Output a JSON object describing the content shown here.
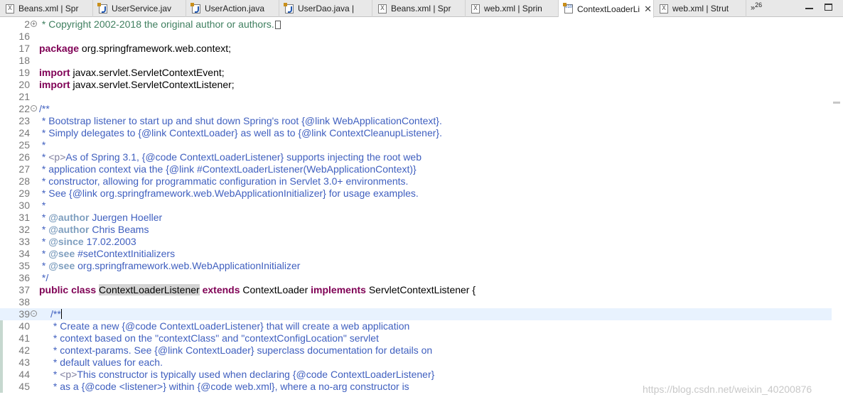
{
  "tabs": [
    {
      "label": "Beans.xml | Spr",
      "icon": "xml-file-icon"
    },
    {
      "label": "UserService.jav",
      "icon": "java-file-icon"
    },
    {
      "label": "UserAction.java",
      "icon": "java-file-icon"
    },
    {
      "label": "UserDao.java |",
      "icon": "java-file-icon"
    },
    {
      "label": "Beans.xml | Spr",
      "icon": "xml-file-icon"
    },
    {
      "label": "web.xml | Sprin",
      "icon": "xml-file-icon"
    },
    {
      "label": "ContextLoaderLi",
      "icon": "class-file-icon",
      "active": true
    },
    {
      "label": "web.xml | Strut",
      "icon": "xml-file-icon"
    }
  ],
  "tab_overflow": {
    "chevrons": "»",
    "count": "26"
  },
  "close_glyph": "✕",
  "xml_icon_glyph": "X",
  "class_icon_glyph": "010",
  "code_lines": [
    {
      "n": "2",
      "fold": "+",
      "parts": [
        {
          "t": " * Copyright 2002-2018 the original author or authors.",
          "c": "cm"
        }
      ],
      "box": true
    },
    {
      "n": "16",
      "parts": []
    },
    {
      "n": "17",
      "parts": [
        {
          "t": "package",
          "c": "kw"
        },
        {
          "t": " org.springframework.web.context;",
          "c": "pl"
        }
      ]
    },
    {
      "n": "18",
      "parts": []
    },
    {
      "n": "19",
      "parts": [
        {
          "t": "import",
          "c": "kw"
        },
        {
          "t": " javax.servlet.ServletContextEvent;",
          "c": "pl"
        }
      ]
    },
    {
      "n": "20",
      "parts": [
        {
          "t": "import",
          "c": "kw"
        },
        {
          "t": " javax.servlet.ServletContextListener;",
          "c": "pl"
        }
      ]
    },
    {
      "n": "21",
      "parts": []
    },
    {
      "n": "22",
      "fold": "-",
      "parts": [
        {
          "t": "/**",
          "c": "jd"
        }
      ]
    },
    {
      "n": "23",
      "parts": [
        {
          "t": " * Bootstrap listener to start up and shut down Spring's root {@link WebApplicationContext}.",
          "c": "jd"
        }
      ]
    },
    {
      "n": "24",
      "parts": [
        {
          "t": " * Simply delegates to {@link ContextLoader} as well as to {@link ContextCleanupListener}.",
          "c": "jd"
        }
      ]
    },
    {
      "n": "25",
      "parts": [
        {
          "t": " *",
          "c": "jd"
        }
      ]
    },
    {
      "n": "26",
      "parts": [
        {
          "t": " * ",
          "c": "jd"
        },
        {
          "t": "<p>",
          "c": "jdh"
        },
        {
          "t": "As of Spring 3.1, {@code ContextLoaderListener} supports injecting the root web",
          "c": "jd"
        }
      ]
    },
    {
      "n": "27",
      "parts": [
        {
          "t": " * application context via the {@link #ContextLoaderListener(WebApplicationContext)}",
          "c": "jd"
        }
      ]
    },
    {
      "n": "28",
      "parts": [
        {
          "t": " * constructor, allowing for programmatic configuration in Servlet 3.0+ environments.",
          "c": "jd"
        }
      ]
    },
    {
      "n": "29",
      "parts": [
        {
          "t": " * See {@link org.springframework.web.WebApplicationInitializer} for usage examples.",
          "c": "jd"
        }
      ]
    },
    {
      "n": "30",
      "parts": [
        {
          "t": " *",
          "c": "jd"
        }
      ]
    },
    {
      "n": "31",
      "parts": [
        {
          "t": " * ",
          "c": "jd"
        },
        {
          "t": "@author",
          "c": "jdtag"
        },
        {
          "t": " Juergen Hoeller",
          "c": "jd"
        }
      ]
    },
    {
      "n": "32",
      "parts": [
        {
          "t": " * ",
          "c": "jd"
        },
        {
          "t": "@author",
          "c": "jdtag"
        },
        {
          "t": " Chris Beams",
          "c": "jd"
        }
      ]
    },
    {
      "n": "33",
      "parts": [
        {
          "t": " * ",
          "c": "jd"
        },
        {
          "t": "@since",
          "c": "jdtag"
        },
        {
          "t": " 17.02.2003",
          "c": "jd"
        }
      ]
    },
    {
      "n": "34",
      "parts": [
        {
          "t": " * ",
          "c": "jd"
        },
        {
          "t": "@see",
          "c": "jdtag"
        },
        {
          "t": " #setContextInitializers",
          "c": "jd"
        }
      ]
    },
    {
      "n": "35",
      "parts": [
        {
          "t": " * ",
          "c": "jd"
        },
        {
          "t": "@see",
          "c": "jdtag"
        },
        {
          "t": " org.springframework.web.WebApplicationInitializer",
          "c": "jd"
        }
      ]
    },
    {
      "n": "36",
      "parts": [
        {
          "t": " */",
          "c": "jd"
        }
      ]
    },
    {
      "n": "37",
      "parts": [
        {
          "t": "public class",
          "c": "kw"
        },
        {
          "t": " ",
          "c": "pl"
        },
        {
          "t": "ContextLoaderListener",
          "c": "pl",
          "hl": true
        },
        {
          "t": " ",
          "c": "pl"
        },
        {
          "t": "extends",
          "c": "kw"
        },
        {
          "t": " ContextLoader ",
          "c": "pl"
        },
        {
          "t": "implements",
          "c": "kw"
        },
        {
          "t": " ServletContextListener {",
          "c": "pl"
        }
      ]
    },
    {
      "n": "38",
      "parts": []
    },
    {
      "n": "39",
      "fold": "-",
      "current": true,
      "indent": true,
      "caret": true,
      "parts": [
        {
          "t": "/**",
          "c": "jd"
        }
      ]
    },
    {
      "n": "40",
      "indent": true,
      "parts": [
        {
          "t": " * Create a new {@code ContextLoaderListener} that will create a web application",
          "c": "jd"
        }
      ]
    },
    {
      "n": "41",
      "indent": true,
      "parts": [
        {
          "t": " * context based on the \"contextClass\" and \"contextConfigLocation\" servlet",
          "c": "jd"
        }
      ]
    },
    {
      "n": "42",
      "indent": true,
      "parts": [
        {
          "t": " * context-params. See {@link ContextLoader} superclass documentation for details on",
          "c": "jd"
        }
      ]
    },
    {
      "n": "43",
      "indent": true,
      "parts": [
        {
          "t": " * default values for each.",
          "c": "jd"
        }
      ]
    },
    {
      "n": "44",
      "indent": true,
      "parts": [
        {
          "t": " * ",
          "c": "jd"
        },
        {
          "t": "<p>",
          "c": "jdh"
        },
        {
          "t": "This constructor is typically used when declaring {@code ContextLoaderListener}",
          "c": "jd"
        }
      ]
    },
    {
      "n": "45",
      "indent": true,
      "parts": [
        {
          "t": " * as a {@code <listener>} within {@code web.xml}, where a no-arg constructor is",
          "c": "jd"
        }
      ]
    }
  ],
  "watermark": "https://blog.csdn.net/weixin_40200876"
}
